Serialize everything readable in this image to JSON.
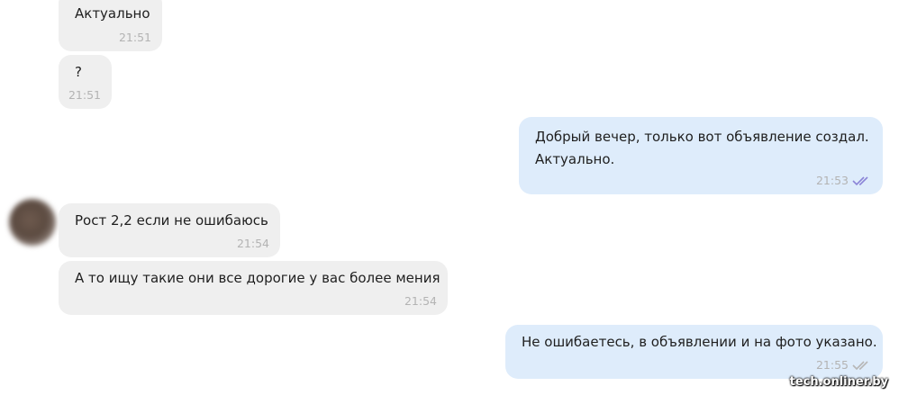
{
  "messages": [
    {
      "text": "Актуально",
      "time": "21:51"
    },
    {
      "text": "?",
      "time": "21:51"
    },
    {
      "line1": "Добрый вечер, только вот объявление создал.",
      "line2": "Актуально.",
      "time": "21:53"
    },
    {
      "text": "Рост 2,2 если не ошибаюсь",
      "time": "21:54"
    },
    {
      "text": "А то ищу такие они все дорогие у вас более мения",
      "time": "21:54"
    },
    {
      "text": "Не ошибаетесь, в объявлении и на фото указано.",
      "time": "21:55"
    }
  ],
  "watermark": "tech.onliner.by",
  "colors": {
    "incoming_bubble": "#efefef",
    "outgoing_bubble": "#deecfb",
    "read_check_active": "#8b84d7",
    "read_check_inactive": "#b6b6b6"
  }
}
